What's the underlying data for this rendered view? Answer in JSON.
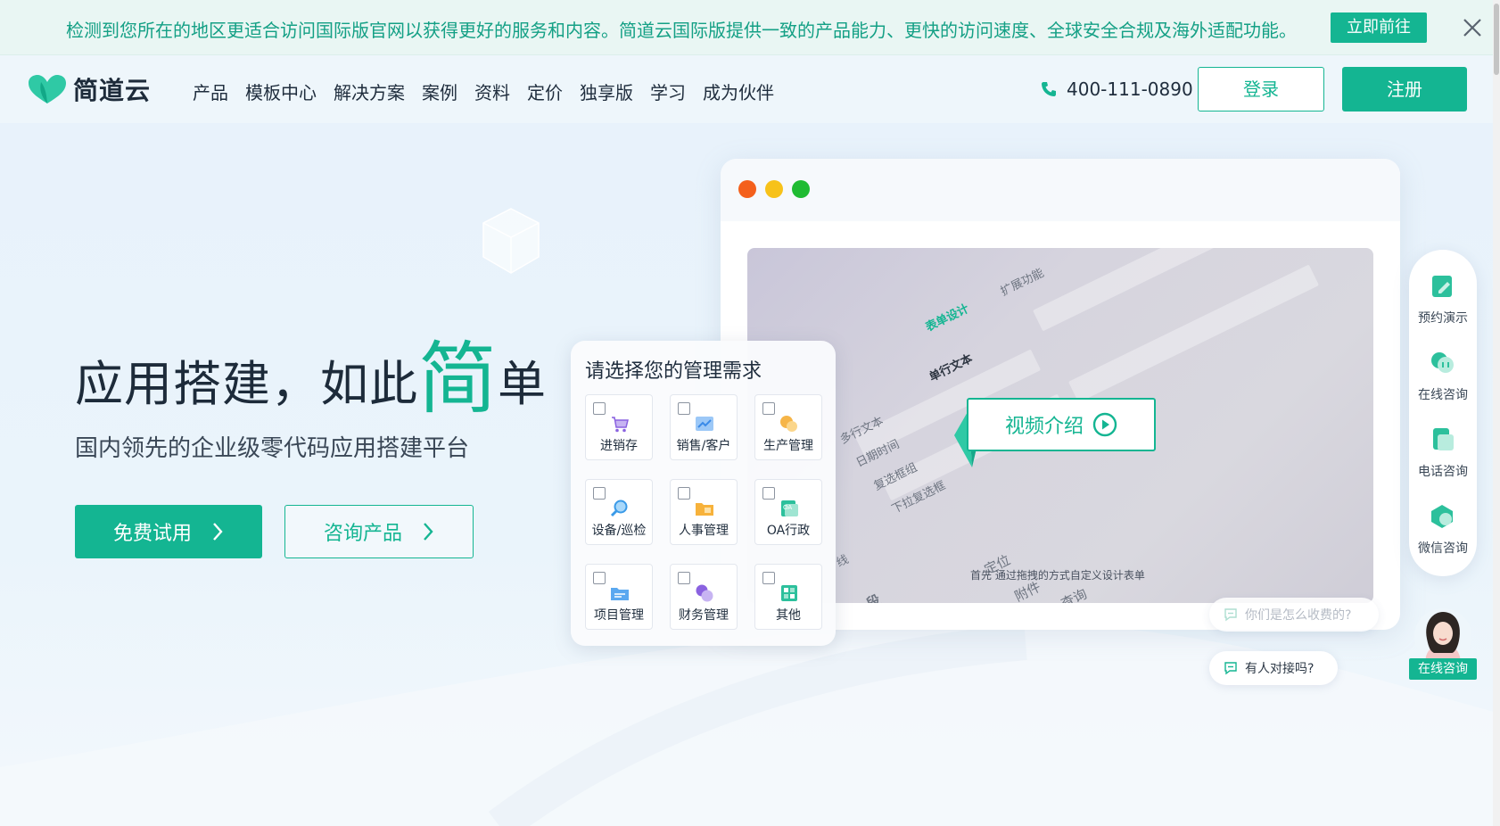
{
  "notice": {
    "text": "检测到您所在的地区更适合访问国际版官网以获得更好的服务和内容。简道云国际版提供一致的产品能力、更快的访问速度、全球安全合规及海外适配功能。",
    "cta": "立即前往"
  },
  "header": {
    "logo_text": "简道云",
    "nav": [
      "产品",
      "模板中心",
      "解决方案",
      "案例",
      "资料",
      "定价",
      "独享版",
      "学习",
      "成为伙伴"
    ],
    "phone": "400-111-0890",
    "login": "登录",
    "register": "注册"
  },
  "hero": {
    "title_pre": "应用搭建，如此",
    "title_big": "简",
    "title_post": "单",
    "subtitle": "国内领先的企业级零代码应用搭建平台",
    "btn_trial": "免费试用",
    "btn_consult": "咨询产品"
  },
  "video": {
    "button": "视频介绍",
    "caption": "首先  通过拖拽的方式自定义设计表单",
    "mock_texts": [
      "表单设计",
      "扩展功能",
      "单行文本",
      "多行文本",
      "日期时间",
      "复选框组",
      "下拉复选框",
      "定位",
      "附件",
      "查询",
      "线",
      "段"
    ]
  },
  "needs": {
    "title": "请选择您的管理需求",
    "items": [
      {
        "label": "进销存",
        "icon": "cart-icon"
      },
      {
        "label": "销售/客户",
        "icon": "chart-icon"
      },
      {
        "label": "生产管理",
        "icon": "gear-coins-icon"
      },
      {
        "label": "设备/巡检",
        "icon": "magnifier-icon"
      },
      {
        "label": "人事管理",
        "icon": "folder-person-icon"
      },
      {
        "label": "OA行政",
        "icon": "oa-icon"
      },
      {
        "label": "项目管理",
        "icon": "folder-icon"
      },
      {
        "label": "财务管理",
        "icon": "coin-icon"
      },
      {
        "label": "其他",
        "icon": "grid-icon"
      }
    ]
  },
  "float_panel": {
    "items": [
      {
        "label": "预约演示",
        "icon": "edit-icon"
      },
      {
        "label": "在线咨询",
        "icon": "chat-icon"
      },
      {
        "label": "电话咨询",
        "icon": "phone-icon"
      },
      {
        "label": "微信咨询",
        "icon": "wechat-icon"
      }
    ]
  },
  "chat": {
    "bubble1": "你们是怎么收费的?",
    "bubble2": "有人对接吗?",
    "online_tag": "在线咨询"
  },
  "colors": {
    "brand": "#14b592",
    "text": "#1f2d3d",
    "notice_bg": "#e9f6f3"
  }
}
